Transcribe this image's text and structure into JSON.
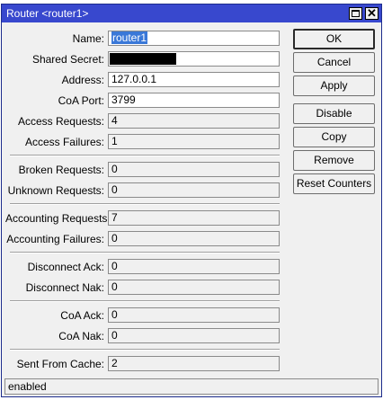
{
  "window": {
    "title": "Router <router1>"
  },
  "form": {
    "name": {
      "label": "Name:",
      "value": "router1"
    },
    "shared_secret": {
      "label": "Shared Secret:",
      "value": ""
    },
    "address": {
      "label": "Address:",
      "value": "127.0.0.1"
    },
    "coa_port": {
      "label": "CoA Port:",
      "value": "3799"
    },
    "access_requests": {
      "label": "Access Requests:",
      "value": "4"
    },
    "access_failures": {
      "label": "Access Failures:",
      "value": "1"
    },
    "broken_requests": {
      "label": "Broken Requests:",
      "value": "0"
    },
    "unknown_requests": {
      "label": "Unknown Requests:",
      "value": "0"
    },
    "accounting_requests": {
      "label": "Accounting Requests:",
      "value": "7"
    },
    "accounting_failures": {
      "label": "Accounting Failures:",
      "value": "0"
    },
    "disconnect_ack": {
      "label": "Disconnect Ack:",
      "value": "0"
    },
    "disconnect_nak": {
      "label": "Disconnect Nak:",
      "value": "0"
    },
    "coa_ack": {
      "label": "CoA Ack:",
      "value": "0"
    },
    "coa_nak": {
      "label": "CoA Nak:",
      "value": "0"
    },
    "sent_from_cache": {
      "label": "Sent From Cache:",
      "value": "2"
    }
  },
  "buttons": {
    "ok": "OK",
    "cancel": "Cancel",
    "apply": "Apply",
    "disable": "Disable",
    "copy": "Copy",
    "remove": "Remove",
    "reset_counters": "Reset Counters"
  },
  "status": "enabled"
}
